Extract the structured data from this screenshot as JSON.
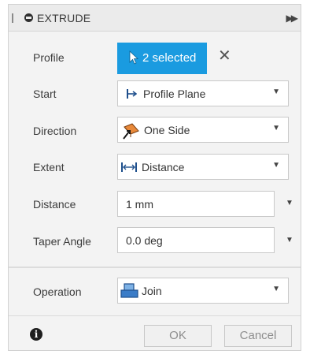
{
  "dialog": {
    "title": "EXTRUDE",
    "expand_icon": "double-chevron-right-icon"
  },
  "profile": {
    "label": "Profile",
    "selection_text": "2 selected",
    "selection_color": "#1a9be0",
    "clear_symbol": "✕"
  },
  "start": {
    "label": "Start",
    "value": "Profile Plane"
  },
  "direction": {
    "label": "Direction",
    "value": "One Side"
  },
  "extent": {
    "label": "Extent",
    "value": "Distance"
  },
  "distance": {
    "label": "Distance",
    "value": "1 mm"
  },
  "taper_angle": {
    "label": "Taper Angle",
    "value": "0.0 deg"
  },
  "operation": {
    "label": "Operation",
    "value": "Join"
  },
  "footer": {
    "info_symbol": "i",
    "ok_label": "OK",
    "cancel_label": "Cancel"
  }
}
